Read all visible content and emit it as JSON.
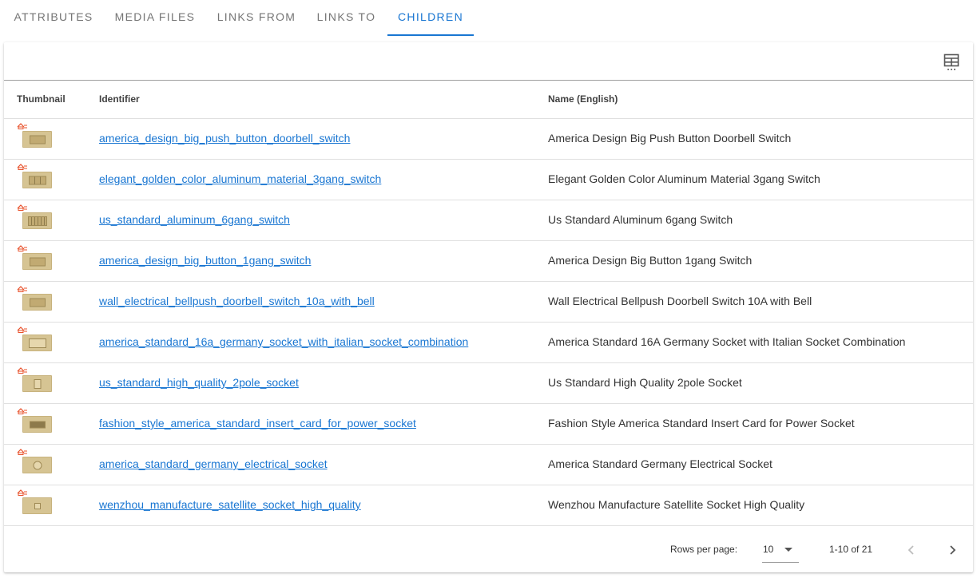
{
  "tabs": [
    {
      "label": "Attributes",
      "active": false
    },
    {
      "label": "Media files",
      "active": false
    },
    {
      "label": "Links from",
      "active": false
    },
    {
      "label": "Links to",
      "active": false
    },
    {
      "label": "Children",
      "active": true
    }
  ],
  "accent_color": "#1976d2",
  "toolbar": {
    "columns_icon": "view-column-icon"
  },
  "table": {
    "headers": {
      "thumbnail": "Thumbnail",
      "identifier": "Identifier",
      "name": "Name (English)"
    },
    "rows": [
      {
        "identifier": "america_design_big_push_button_doorbell_switch",
        "name": "America Design Big Push Button Doorbell Switch",
        "thumb": "switch-1"
      },
      {
        "identifier": "elegant_golden_color_aluminum_material_3gang_switch",
        "name": "Elegant Golden Color Aluminum Material 3gang Switch",
        "thumb": "switch-3"
      },
      {
        "identifier": "us_standard_aluminum_6gang_switch",
        "name": "Us Standard Aluminum 6gang Switch",
        "thumb": "switch-6"
      },
      {
        "identifier": "america_design_big_button_1gang_switch",
        "name": "America Design Big Button 1gang Switch",
        "thumb": "switch-1"
      },
      {
        "identifier": "wall_electrical_bellpush_doorbell_switch_10a_with_bell",
        "name": "Wall Electrical Bellpush Doorbell Switch 10A with Bell",
        "thumb": "switch-1"
      },
      {
        "identifier": "america_standard_16a_germany_socket_with_italian_socket_combination",
        "name": "America Standard 16A Germany Socket with Italian Socket Combination",
        "thumb": "socket-combo"
      },
      {
        "identifier": "us_standard_high_quality_2pole_socket",
        "name": "Us Standard High Quality 2pole Socket",
        "thumb": "socket-2pole"
      },
      {
        "identifier": "fashion_style_america_standard_insert_card_for_power_socket",
        "name": "Fashion Style America Standard Insert Card for Power Socket",
        "thumb": "card"
      },
      {
        "identifier": "america_standard_germany_electrical_socket",
        "name": "America Standard Germany Electrical Socket",
        "thumb": "socket-round"
      },
      {
        "identifier": "wenzhou_manufacture_satellite_socket_high_quality",
        "name": "Wenzhou Manufacture Satellite Socket High Quality",
        "thumb": "socket-sat"
      }
    ]
  },
  "pagination": {
    "rows_per_page_label": "Rows per page:",
    "rows_per_page_value": "10",
    "range_text": "1-10 of 21",
    "prev_icon": "chevron-left-icon",
    "next_icon": "chevron-right-icon"
  }
}
